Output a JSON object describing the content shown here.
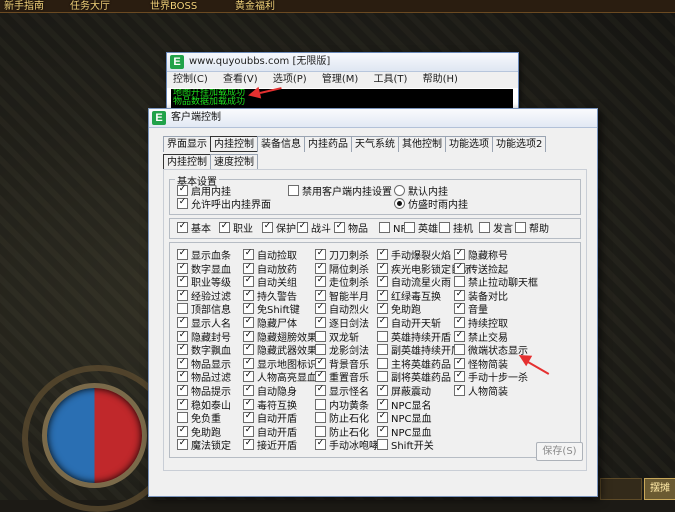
{
  "topbar": [
    "新手指南",
    "任务大厅",
    "世界BOSS",
    "黄金福利"
  ],
  "corner_button": "摆摊",
  "window_back": {
    "title": "www.quyoubbs.com [无限版]",
    "menu": [
      "控制(C)",
      "查看(V)",
      "选项(P)",
      "管理(M)",
      "工具(T)",
      "帮助(H)"
    ],
    "log": [
      "地图开挂加载成功",
      "物品数据加载成功"
    ]
  },
  "window_main": {
    "title": "客户端控制",
    "tabs": [
      "界面显示",
      "内挂控制",
      "装备信息",
      "内挂药品",
      "天气系统",
      "其他控制",
      "功能选项",
      "功能选项2"
    ],
    "active_tab": "内挂控制",
    "subtabs": [
      "内挂控制",
      "速度控制"
    ],
    "basic": {
      "group_label": "基本设置",
      "enable": {
        "label": "启用内挂",
        "checked": true
      },
      "allow_call": {
        "label": "允许呼出内挂界面",
        "checked": true
      },
      "disable_client": {
        "label": "禁用客户端内挂设置",
        "checked": false
      },
      "radio_default": {
        "label": "默认内挂",
        "checked": false
      },
      "radio_shengchu": {
        "label": "仿盛时雨内挂",
        "checked": true
      }
    },
    "category_filters": [
      {
        "label": "基本",
        "checked": true
      },
      {
        "label": "职业",
        "checked": true
      },
      {
        "label": "保护",
        "checked": true
      },
      {
        "label": "战斗",
        "checked": true
      },
      {
        "label": "物品",
        "checked": true
      },
      {
        "label": "NPC",
        "checked": false
      },
      {
        "label": "英雄",
        "checked": false
      },
      {
        "label": "挂机",
        "checked": false
      },
      {
        "label": "发言",
        "checked": false
      },
      {
        "label": "帮助",
        "checked": false
      }
    ],
    "options": [
      [
        {
          "label": "显示血条",
          "checked": true
        },
        {
          "label": "数字显血",
          "checked": true
        },
        {
          "label": "职业等级",
          "checked": true
        },
        {
          "label": "经验过滤",
          "checked": true
        },
        {
          "label": "顶部信息",
          "checked": false
        },
        {
          "label": "显示人名",
          "checked": true
        },
        {
          "label": "隐藏封号",
          "checked": true
        },
        {
          "label": "数字飘血",
          "checked": true
        },
        {
          "label": "物品显示",
          "checked": true
        },
        {
          "label": "物品过滤",
          "checked": true
        },
        {
          "label": "物品提示",
          "checked": true
        },
        {
          "label": "稳如泰山",
          "checked": true
        },
        {
          "label": "免负重",
          "checked": false
        },
        {
          "label": "免助跑",
          "checked": true
        },
        {
          "label": "魔法锁定",
          "checked": true
        }
      ],
      [
        {
          "label": "自动捡取",
          "checked": true
        },
        {
          "label": "自动放药",
          "checked": true
        },
        {
          "label": "自动关组",
          "checked": true
        },
        {
          "label": "持久警告",
          "checked": true
        },
        {
          "label": "免Shift键",
          "checked": true
        },
        {
          "label": "隐藏尸体",
          "checked": true
        },
        {
          "label": "隐藏翅膀效果",
          "checked": true
        },
        {
          "label": "隐藏武器效果",
          "checked": true
        },
        {
          "label": "显示地图标识",
          "checked": true
        },
        {
          "label": "人物高亮显血",
          "checked": true
        },
        {
          "label": "自动隐身",
          "checked": true
        },
        {
          "label": "毒符互换",
          "checked": true
        },
        {
          "label": "自动开盾",
          "checked": true
        },
        {
          "label": "自动开盾",
          "checked": true
        },
        {
          "label": "接近开盾",
          "checked": true
        }
      ],
      [
        {
          "label": "刀刀刺杀",
          "checked": true
        },
        {
          "label": "隔位刺杀",
          "checked": true
        },
        {
          "label": "走位刺杀",
          "checked": true
        },
        {
          "label": "智能半月",
          "checked": true
        },
        {
          "label": "自动烈火",
          "checked": true
        },
        {
          "label": "逐日剑法",
          "checked": true
        },
        {
          "label": "双龙斩",
          "checked": false
        },
        {
          "label": "龙影剑法",
          "checked": false
        },
        {
          "label": "背景音乐",
          "checked": true
        },
        {
          "label": "重置音乐",
          "checked": true
        },
        {
          "label": "显示怪名",
          "checked": true
        },
        {
          "label": "内功黄条",
          "checked": false
        },
        {
          "label": "防止石化",
          "checked": false
        },
        {
          "label": "防止石化",
          "checked": false
        },
        {
          "label": "手动冰咆哮",
          "checked": true
        }
      ],
      [
        {
          "label": "手动爆裂火焰",
          "checked": true
        },
        {
          "label": "疾光电影锁定目标",
          "checked": true
        },
        {
          "label": "自动流星火雨",
          "checked": true
        },
        {
          "label": "红绿毒互换",
          "checked": true
        },
        {
          "label": "免助跑",
          "checked": true
        },
        {
          "label": "自动开天斩",
          "checked": true
        },
        {
          "label": "英雄持续开盾",
          "checked": false
        },
        {
          "label": "副英雄持续开盾",
          "checked": false
        },
        {
          "label": "主将英雄药品",
          "checked": false
        },
        {
          "label": "副将英雄药品",
          "checked": false
        },
        {
          "label": "屏蔽震动",
          "checked": true
        },
        {
          "label": "NPC显名",
          "checked": true
        },
        {
          "label": "NPC显血",
          "checked": true
        },
        {
          "label": "NPC显血",
          "checked": true
        },
        {
          "label": "Shift开关",
          "checked": false
        }
      ],
      [
        {
          "label": "隐藏称号",
          "checked": true
        },
        {
          "label": "传送捡起",
          "checked": true
        },
        {
          "label": "禁止拉动聊天框",
          "checked": false
        },
        {
          "label": "装备对比",
          "checked": true
        },
        {
          "label": "音量",
          "checked": true
        },
        {
          "label": "持续控取",
          "checked": true
        },
        {
          "label": "禁止交易",
          "checked": true
        },
        {
          "label": "微端状态显示",
          "checked": false
        },
        {
          "label": "怪物简装",
          "checked": true
        },
        {
          "label": "手动十步一杀",
          "checked": true
        },
        {
          "label": "人物简装",
          "checked": true
        }
      ]
    ],
    "save_button": "保存(S)"
  }
}
